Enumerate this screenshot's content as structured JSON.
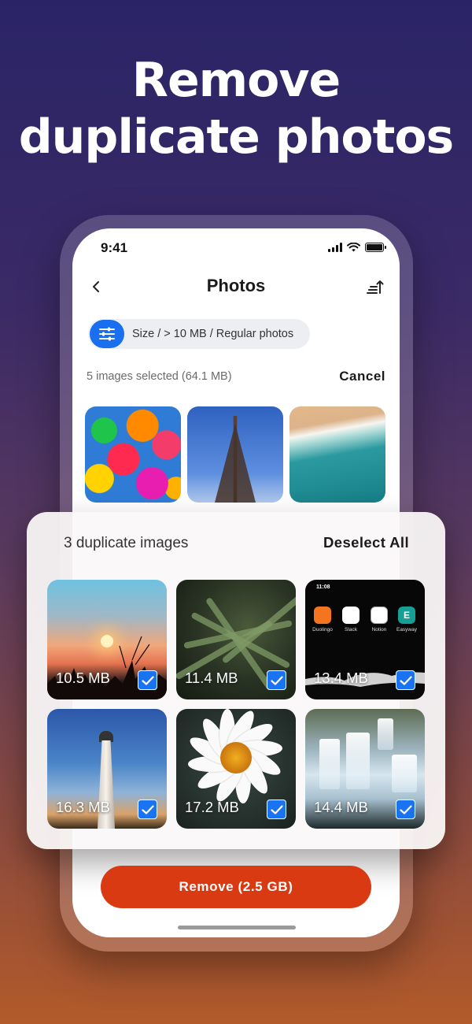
{
  "headline": {
    "line1": "Remove",
    "line2": "duplicate photos"
  },
  "status_bar": {
    "time": "9:41"
  },
  "nav": {
    "title": "Photos"
  },
  "filter": {
    "label": "Size / > 10 MB / Regular photos"
  },
  "selection": {
    "summary": "5 images selected (64.1 MB)",
    "cancel_label": "Cancel"
  },
  "top_photos": [
    {
      "icon": "umbrellas-photo"
    },
    {
      "icon": "eiffel-tower-photo"
    },
    {
      "icon": "beach-photo"
    }
  ],
  "duplicates": {
    "title": "3 duplicate images",
    "deselect_label": "Deselect All",
    "items": [
      {
        "size": "10.5 MB",
        "selected": true
      },
      {
        "size": "11.4 MB",
        "selected": true
      },
      {
        "size": "13.4 MB",
        "selected": true
      },
      {
        "size": "16.3 MB",
        "selected": true
      },
      {
        "size": "17.2 MB",
        "selected": true
      },
      {
        "size": "14.4 MB",
        "selected": true
      }
    ],
    "screenshot_preview": {
      "time": "11:08",
      "apps": [
        "Duolingo",
        "Slack",
        "Notion",
        "Easyway"
      ]
    }
  },
  "remove_button": {
    "label": "Remove (2.5 GB)"
  },
  "colors": {
    "accent_blue": "#1a73f0",
    "remove_red": "#d93a12"
  }
}
